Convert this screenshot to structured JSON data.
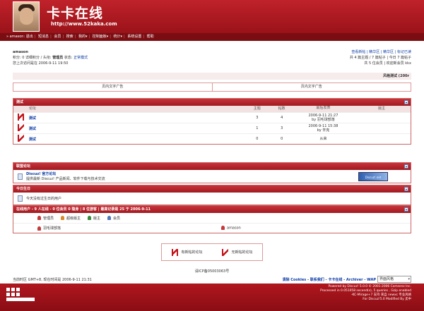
{
  "header": {
    "site_title": "卡卡在线",
    "site_url": "http://www.52kaka.com"
  },
  "nav": [
    "» amason: 退出",
    "短消息",
    "会员",
    "搜索",
    "我的▾",
    "控制面板▾",
    "统计▾",
    "系统设置",
    "帮助"
  ],
  "user": {
    "name": "amason",
    "line1_prefix": "积分: 0 详细积分 / 头衔: ",
    "rank": "管理员",
    "line1_mid": " 状态: ",
    "status": "正常模式",
    "last_visit": "您上次访问是在 2006-9-11 19:50"
  },
  "right_info": {
    "links": "查看新帖 | 精华区 | 精华区 | 标记已读",
    "stats1": "共 4 篇主题 / 7 篇帖子 | 今日 7 篇帖子",
    "stats2": "共 5 位会员 | 欢迎新会员 kkx"
  },
  "style_bar": "风格测试 (200r",
  "ads": [
    "页内文字广告",
    "页内文字广告"
  ],
  "category": {
    "name": "测试",
    "columns": {
      "forum": "论坛",
      "topics": "主题",
      "posts": "帖数",
      "last": "最后发表",
      "mod": "版主"
    },
    "forums": [
      {
        "name": "测试",
        "topics": "3",
        "posts": "4",
        "last_date": "2006-9-11 21:27",
        "last_by": "by 羽毛球部落",
        "mod": "",
        "icon": "new"
      },
      {
        "name": "测试",
        "topics": "1",
        "posts": "3",
        "last_date": "2006-9-11 15:38",
        "last_by": "by 辛克",
        "mod": "",
        "icon": "old"
      },
      {
        "name": "测试",
        "topics": "0",
        "posts": "0",
        "last_date": "从来",
        "last_by": "",
        "mod": "",
        "icon": "old"
      }
    ]
  },
  "promo": {
    "head": "联盟论坛",
    "title": "Discuz! 官方论坛",
    "desc": "提供最新 Discuz! 产品新闻、软件下载与技术交流",
    "banner": "Discuz!.net"
  },
  "birthday": {
    "head": "今日生日",
    "text": "今天没有过生日的用户"
  },
  "online": {
    "head": "在线用户 - 9 人在线 - 0 位会员 0 隐身 | 8 位游客 | 最高记录是 25 于 2006-9-11",
    "legend": [
      "管理员",
      "超级版主",
      "版主",
      "会员"
    ],
    "users": [
      "羽毛球部落",
      "amason"
    ]
  },
  "legend": {
    "new": "有新帖的论坛",
    "nonew": "无新帖的论坛"
  },
  "icp": "请ICP备05003063号",
  "footer": {
    "time": "当前时区 GMT+8, 现在时间是 2006-9-11 21:31",
    "links": "清除 Cookies - 联系我们 - 卡卡在线 - Archiver - WAP",
    "style_select": "界面风格",
    "right1": "Powered by Discuz! 5.0.0 © 2001-2006 Comsenz Inc.",
    "right2": "Processed in 0.051058 second(s), 5 queries , Gzip enabled",
    "right3": "-KC-Mirage+7 支持 来自 newxc 专业风格",
    "right4": "For Discuz!5.0 Modified By 卖中"
  },
  "colors": {
    "brand": "#c0222a",
    "nav": "#7a0d12",
    "link": "#0a3aa5"
  }
}
